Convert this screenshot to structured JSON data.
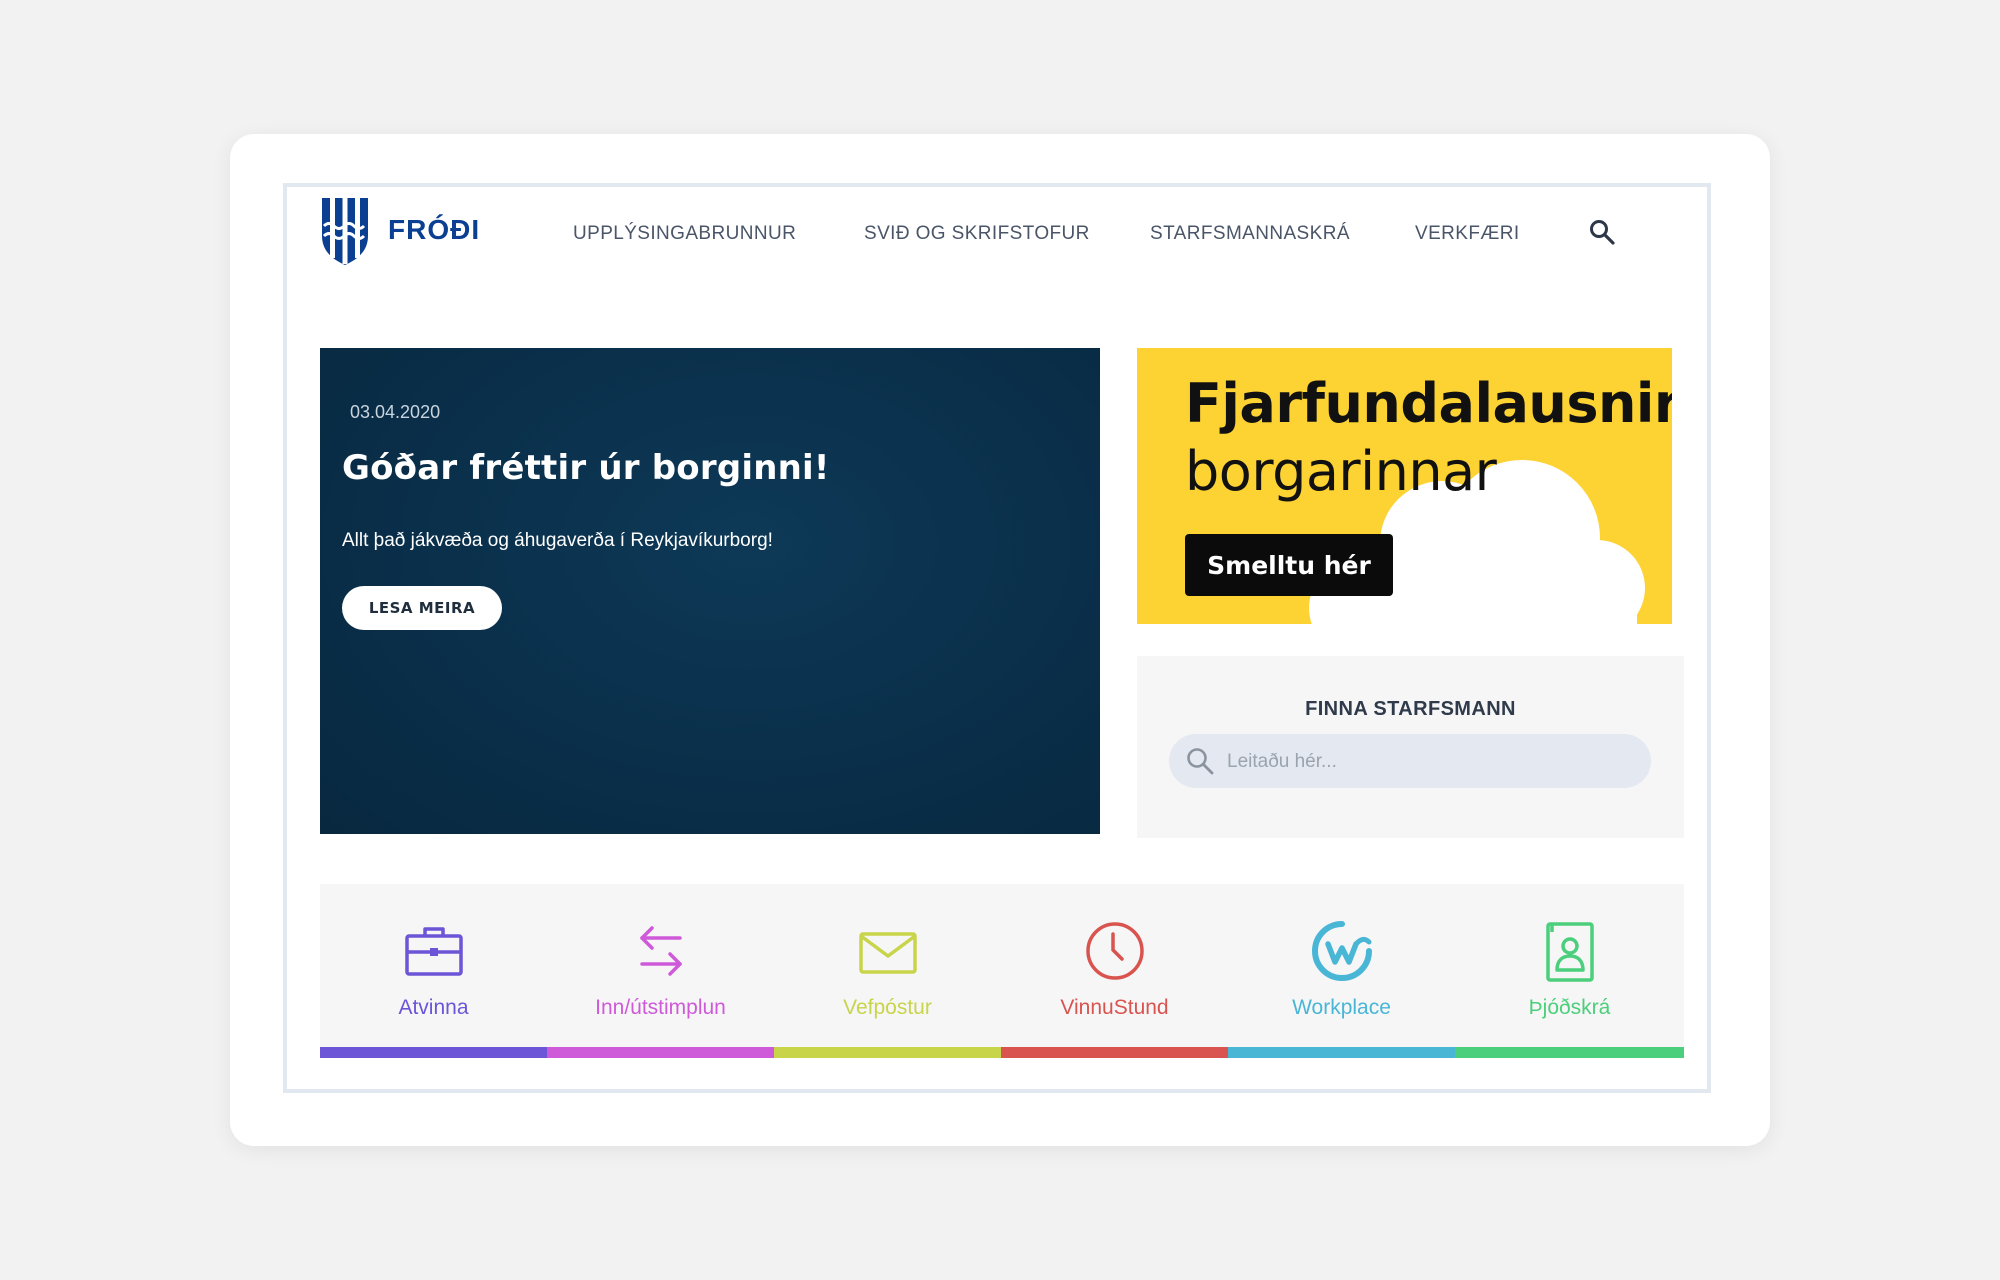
{
  "header": {
    "brand": "FRÓÐI",
    "nav": [
      "UPPLÝSINGABRUNNUR",
      "SVIÐ OG SKRIFSTOFUR",
      "STARFSMANNASKRÁ",
      "VERKFÆRI"
    ],
    "search_icon": "search-icon"
  },
  "hero": {
    "date": "03.04.2020",
    "title": "Góðar fréttir úr borginni!",
    "subtitle": "Allt það jákvæða og áhugaverða í Reykjavíkurborg!",
    "button": "LESA MEIRA"
  },
  "banner": {
    "line1": "Fjarfundalausnir",
    "line2": "borgarinnar",
    "button": "Smelltu hér",
    "background": "#fdd233"
  },
  "finder": {
    "title": "FINNA STARFSMANN",
    "placeholder": "Leitaðu hér..."
  },
  "tiles": [
    {
      "label": "Atvinna",
      "icon": "briefcase-icon",
      "color": "#6c55d6"
    },
    {
      "label": "Inn/útstimplun",
      "icon": "arrows-swap-icon",
      "color": "#cf5ad9"
    },
    {
      "label": "Vefpóstur",
      "icon": "envelope-icon",
      "color": "#c8d44a"
    },
    {
      "label": "VinnuStund",
      "icon": "clock-icon",
      "color": "#d9534f"
    },
    {
      "label": "Workplace",
      "icon": "workplace-icon",
      "color": "#49b6d6"
    },
    {
      "label": "Þjóðskrá",
      "icon": "contact-book-icon",
      "color": "#4ccf7c"
    }
  ]
}
